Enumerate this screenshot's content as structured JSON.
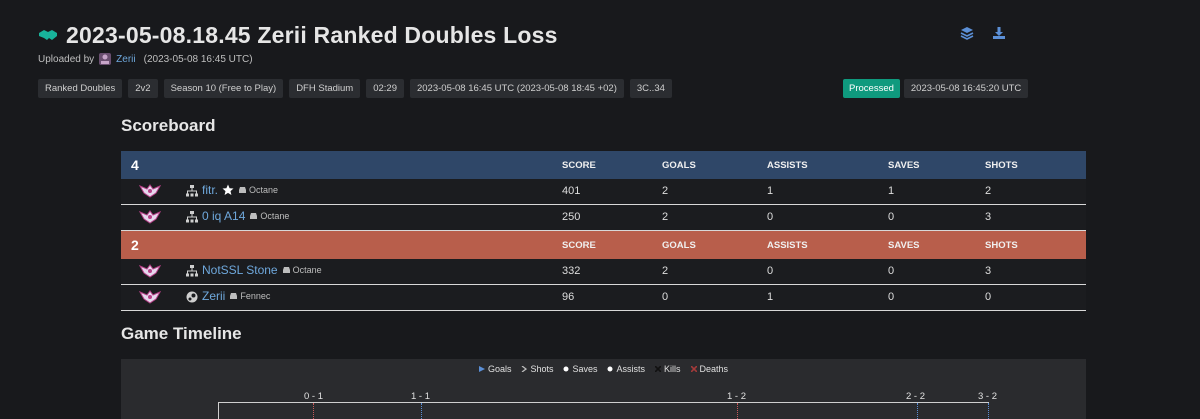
{
  "header": {
    "title": "2023-05-08.18.45 Zerii Ranked Doubles Loss",
    "uploaded_prefix": "Uploaded by",
    "uploader": "Zerii",
    "upload_time": "(2023-05-08 16:45 UTC)",
    "icons": [
      "layers-icon",
      "download-icon"
    ]
  },
  "tags": [
    "Ranked Doubles",
    "2v2",
    "Season 10 (Free to Play)",
    "DFH Stadium",
    "02:29",
    "2023-05-08 16:45 UTC (2023-05-08 18:45 +02)",
    "3C..34"
  ],
  "processing": {
    "status": "Processed",
    "time": "2023-05-08 16:45:20 UTC",
    "status_color": "#0f9a7e"
  },
  "scoreboard": {
    "title": "Scoreboard",
    "columns": [
      "SCORE",
      "GOALS",
      "ASSISTS",
      "SAVES",
      "SHOTS"
    ],
    "teams": [
      {
        "score": "4",
        "color": "#2f4768",
        "players": [
          {
            "name": "fitr.",
            "platform": "network-icon",
            "mvp": true,
            "car": "Octane",
            "stats": [
              "401",
              "2",
              "1",
              "1",
              "2"
            ]
          },
          {
            "name": "0 iq A14",
            "platform": "network-icon",
            "mvp": false,
            "car": "Octane",
            "stats": [
              "250",
              "2",
              "0",
              "0",
              "3"
            ]
          }
        ]
      },
      {
        "score": "2",
        "color": "#b85e4b",
        "players": [
          {
            "name": "NotSSL Stone",
            "platform": "network-icon",
            "mvp": false,
            "car": "Octane",
            "stats": [
              "332",
              "2",
              "0",
              "0",
              "3"
            ]
          },
          {
            "name": "Zerii",
            "platform": "steam-icon",
            "mvp": false,
            "car": "Fennec",
            "stats": [
              "96",
              "0",
              "1",
              "0",
              "0"
            ]
          }
        ]
      }
    ]
  },
  "timeline": {
    "title": "Game Timeline",
    "legend": [
      "Goals",
      "Shots",
      "Saves",
      "Assists",
      "Kills",
      "Deaths"
    ],
    "score_labels": [
      "0 - 1",
      "1 - 1",
      "1 - 2",
      "2 - 2",
      "3 - 2"
    ]
  }
}
